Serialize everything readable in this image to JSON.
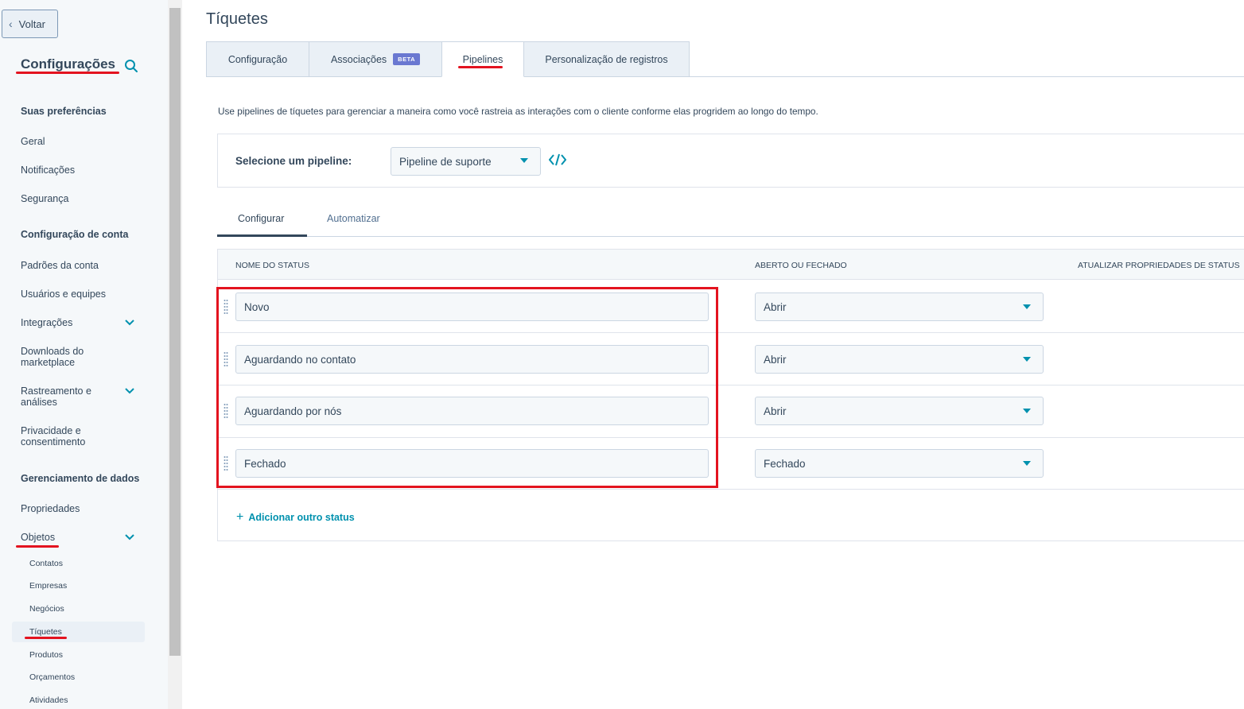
{
  "sidebar": {
    "back_label": "Voltar",
    "title": "Configurações",
    "sections": {
      "preferences": "Suas preferências",
      "account": "Configuração de conta",
      "data": "Gerenciamento de dados"
    },
    "items": {
      "general": "Geral",
      "notifications": "Notificações",
      "security": "Segurança",
      "account_defaults": "Padrões da conta",
      "users_teams": "Usuários e equipes",
      "integrations": "Integrações",
      "marketplace_downloads": "Downloads do marketplace",
      "tracking_analytics": "Rastreamento e análises",
      "privacy_consent": "Privacidade e consentimento",
      "properties": "Propriedades",
      "objects": "Objetos"
    },
    "object_items": {
      "contacts": "Contatos",
      "companies": "Empresas",
      "deals": "Negócios",
      "tickets": "Tíquetes",
      "products": "Produtos",
      "quotes": "Orçamentos",
      "activities": "Atividades"
    },
    "active_item": "Tíquetes"
  },
  "page": {
    "title": "Tíquetes",
    "tabs": {
      "configuration": "Configuração",
      "associations": "Associações",
      "associations_badge": "BETA",
      "pipelines": "Pipelines",
      "record_customization": "Personalização de registros"
    },
    "active_tab": "Pipelines",
    "description": "Use pipelines de tíquetes para gerenciar a maneira como você rastreia as interações com o cliente conforme elas progridem ao longo do tempo.",
    "pipeline": {
      "label": "Selecione um pipeline:",
      "selected": "Pipeline de suporte"
    },
    "inner_tabs": {
      "configure": "Configurar",
      "automate": "Automatizar"
    },
    "table": {
      "headers": {
        "status_name": "NOME DO STATUS",
        "open_closed": "ABERTO OU FECHADO",
        "update_props": "ATUALIZAR PROPRIEDADES DE STATUS"
      },
      "rows": [
        {
          "name": "Novo",
          "state": "Abrir"
        },
        {
          "name": "Aguardando no contato",
          "state": "Abrir"
        },
        {
          "name": "Aguardando por nós",
          "state": "Abrir"
        },
        {
          "name": "Fechado",
          "state": "Fechado"
        }
      ]
    },
    "add_status_label": "Adicionar outro status"
  },
  "colors": {
    "accent": "#0091ae",
    "annotation_red": "#e3131f",
    "text": "#33475b",
    "beta_badge": "#6a78d1"
  }
}
